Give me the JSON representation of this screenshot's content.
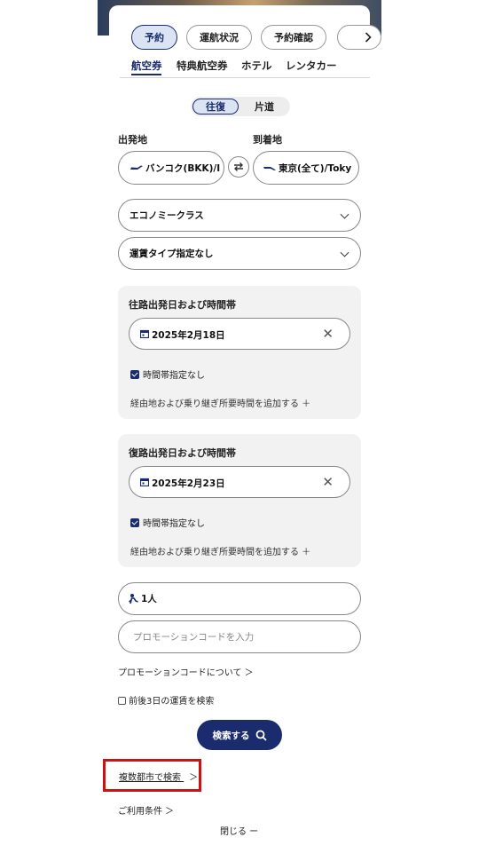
{
  "top_pills": [
    {
      "label": "予約",
      "active": true
    },
    {
      "label": "運航状況",
      "active": false
    },
    {
      "label": "予約確認",
      "active": false
    }
  ],
  "pill_more_icon": "chevron-right-icon",
  "sub_tabs": [
    {
      "label": "航空券",
      "active": true
    },
    {
      "label": "特典航空券",
      "active": false
    },
    {
      "label": "ホテル",
      "active": false
    },
    {
      "label": "レンタカー",
      "active": false
    }
  ],
  "trip_type": {
    "round": "往復",
    "oneway": "片道",
    "selected": "往復"
  },
  "origin": {
    "label": "出発地",
    "value": "バンコク(BKK)/I"
  },
  "destination": {
    "label": "到着地",
    "value": "東京(全て)/Toky"
  },
  "cabin_class": "エコノミークラス",
  "fare_type": "運賃タイプ指定なし",
  "outbound": {
    "title": "往路出発日および時間帯",
    "date": "2025年2月18日",
    "time_checkbox": "時間帯指定なし",
    "via_link": "経由地および乗り継ぎ所要時間を追加する ＋"
  },
  "inbound": {
    "title": "復路出発日および時間帯",
    "date": "2025年2月23日",
    "time_checkbox": "時間帯指定なし",
    "via_link": "経由地および乗り継ぎ所要時間を追加する ＋"
  },
  "passengers": "1人",
  "promo": {
    "placeholder": "プロモーションコードを入力",
    "about_link": "プロモーションコードについて ＞"
  },
  "flex_dates": "前後3日の運賃を検索",
  "search_button": "検索する",
  "multi_city_link": "複数都市で検索",
  "terms_link": "ご利用条件 ＞",
  "close_link": "閉じる ー",
  "colors": {
    "primary": "#1a2c6e",
    "active_bg": "#dbe4f3",
    "highlight": "#cc1111"
  }
}
